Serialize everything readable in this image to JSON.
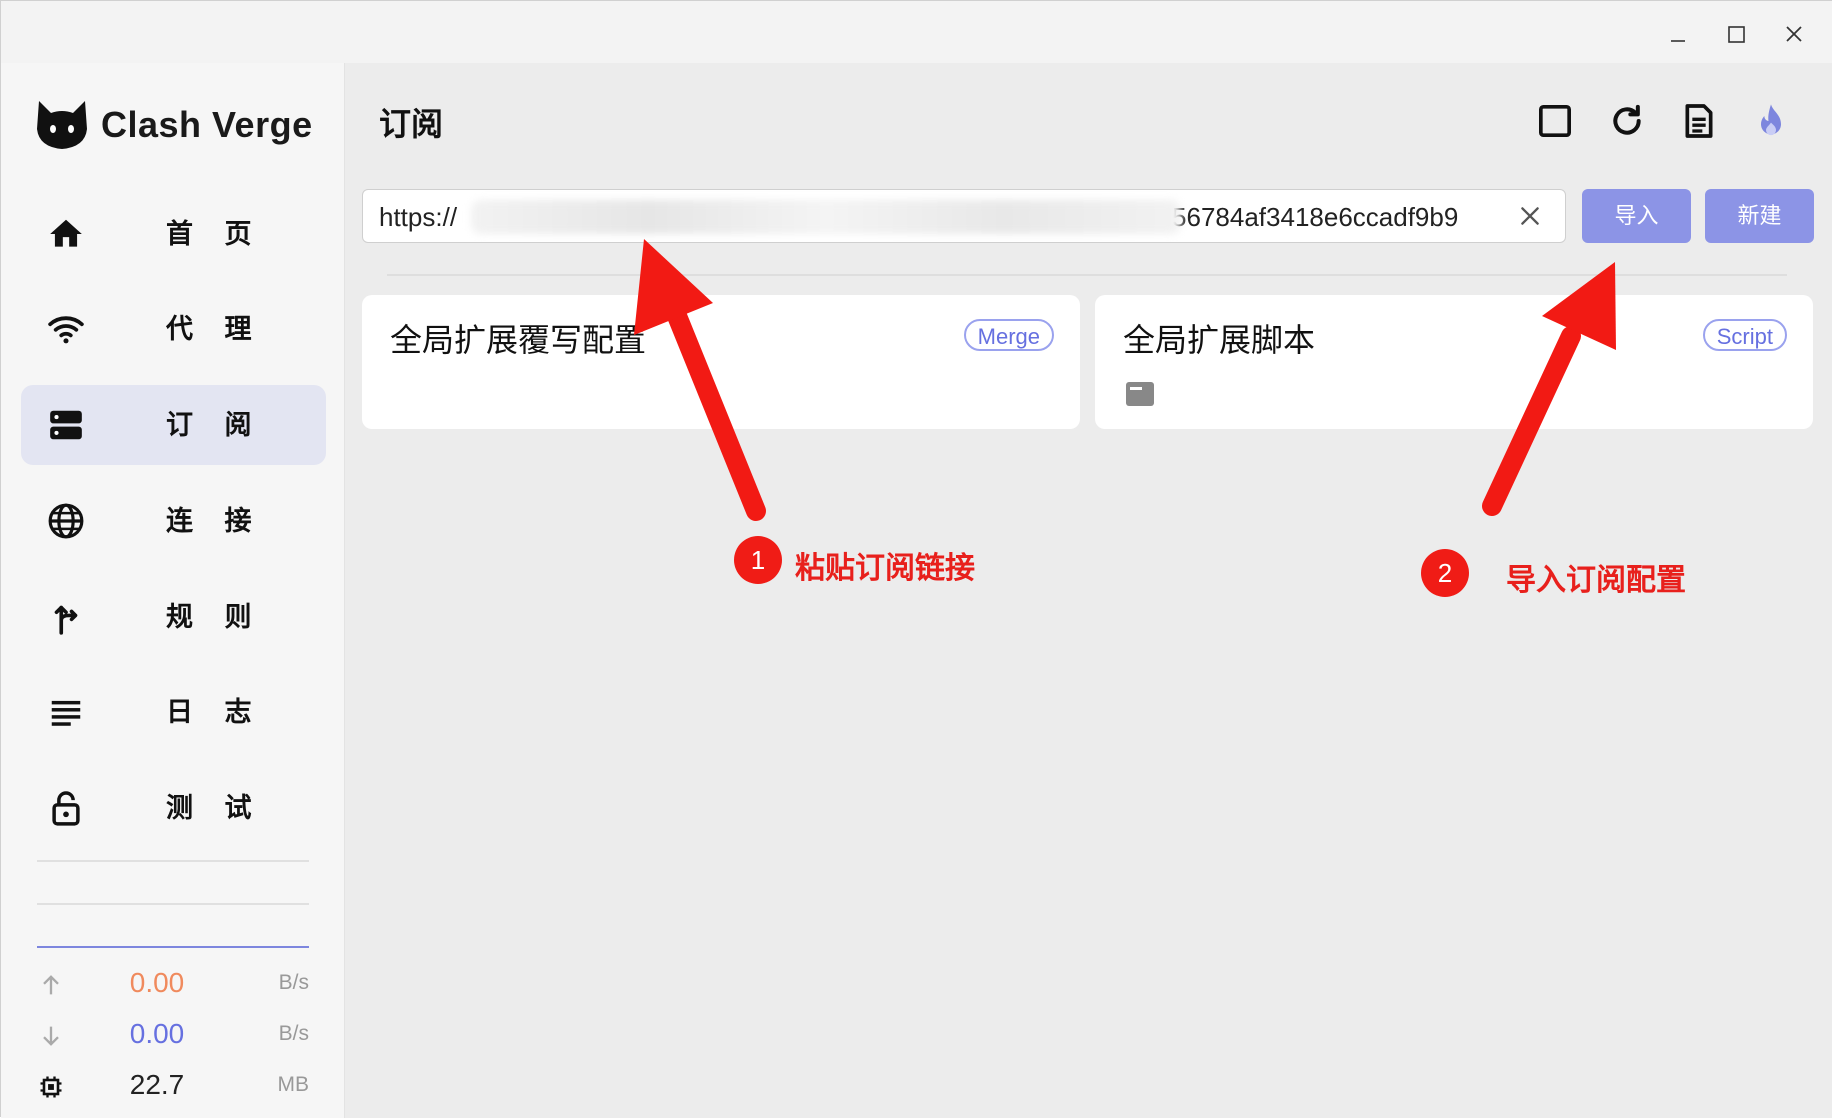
{
  "window": {
    "controls": {
      "minimize_icon": "minimize-icon",
      "maximize_icon": "maximize-icon",
      "close_icon": "close-icon"
    }
  },
  "app": {
    "name": "Clash Verge",
    "logo_icon": "cat-logo-icon"
  },
  "sidebar": {
    "items": [
      {
        "label": "首 页",
        "icon": "home-icon"
      },
      {
        "label": "代 理",
        "icon": "wifi-icon"
      },
      {
        "label": "订 阅",
        "icon": "storage-icon",
        "active": true
      },
      {
        "label": "连 接",
        "icon": "globe-icon"
      },
      {
        "label": "规 则",
        "icon": "fork-icon"
      },
      {
        "label": "日 志",
        "icon": "list-icon"
      },
      {
        "label": "测 试",
        "icon": "lock-icon"
      }
    ],
    "traffic": {
      "upload": {
        "value": "0.00",
        "unit": "B/s",
        "icon": "arrow-up-icon",
        "color": "#f08a5d"
      },
      "download": {
        "value": "0.00",
        "unit": "B/s",
        "icon": "arrow-down-icon",
        "color": "#6670e0"
      },
      "memory": {
        "value": "22.7",
        "unit": "MB",
        "icon": "chip-icon",
        "color": "#222222"
      }
    }
  },
  "main": {
    "title": "订阅",
    "header_icons": [
      "square-icon",
      "refresh-icon",
      "document-icon",
      "fire-icon"
    ],
    "url_input": {
      "value_visible_start": "https://",
      "value_visible_end": "56784af3418e6ccadf9b9",
      "clear_icon": "clear-icon"
    },
    "buttons": {
      "import": "导入",
      "new": "新建"
    },
    "cards": [
      {
        "title": "全局扩展覆写配置",
        "badge": "Merge"
      },
      {
        "title": "全局扩展脚本",
        "badge": "Script",
        "icon": "file-icon"
      }
    ]
  },
  "annotations": [
    {
      "number": "1",
      "text": "粘贴订阅链接"
    },
    {
      "number": "2",
      "text": "导入订阅配置"
    }
  ],
  "colors": {
    "accent": "#8c94e6",
    "arrow": "#f21a14",
    "active_nav": "#e3e5f2"
  }
}
